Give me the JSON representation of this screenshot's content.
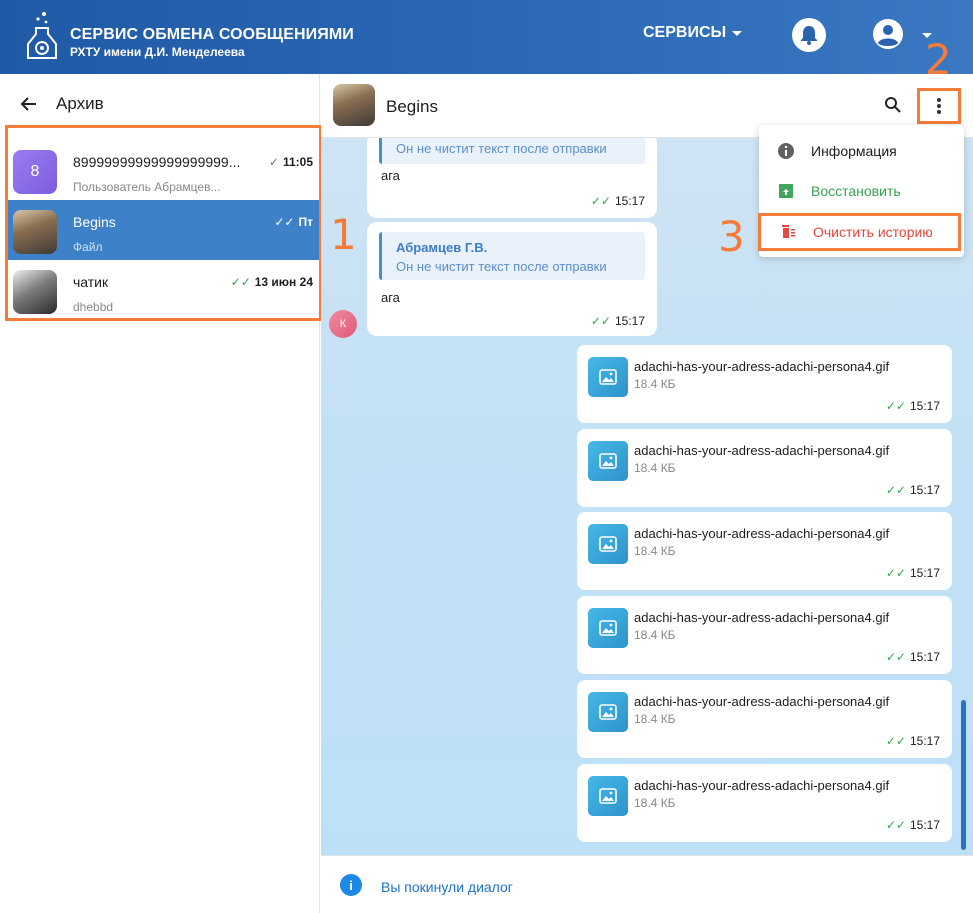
{
  "header": {
    "title": "СЕРВИС ОБМЕНА СООБЩЕНИЯМИ",
    "subtitle": "РХТУ имени Д.И. Менделеева",
    "services_label": "СЕРВИСЫ"
  },
  "archive": {
    "title": "Архив",
    "chats": [
      {
        "avatar_letter": "8",
        "name": "89999999999999999999...",
        "preview": "Пользователь Абрамцев...",
        "time": "11:05"
      },
      {
        "name": "Begins",
        "preview": "Файл",
        "time": "Пт"
      },
      {
        "name": "чатик",
        "preview": "dhebbd",
        "time": "13 июн 24"
      }
    ]
  },
  "chat": {
    "title": "Begins",
    "messages": [
      {
        "quote_text": "Он не чистит текст после отправки",
        "text": "ага",
        "time": "15:17"
      },
      {
        "quote_author": "Абрамцев Г.В.",
        "quote_text": "Он не чистит текст после отправки",
        "text": "ага",
        "time": "15:17",
        "sender_initial": "К"
      }
    ],
    "files": [
      {
        "name": "adachi-has-your-adress-adachi-persona4.gif",
        "size": "18.4 КБ",
        "time": "15:17"
      },
      {
        "name": "adachi-has-your-adress-adachi-persona4.gif",
        "size": "18.4 КБ",
        "time": "15:17"
      },
      {
        "name": "adachi-has-your-adress-adachi-persona4.gif",
        "size": "18.4 КБ",
        "time": "15:17"
      },
      {
        "name": "adachi-has-your-adress-adachi-persona4.gif",
        "size": "18.4 КБ",
        "time": "15:17"
      },
      {
        "name": "adachi-has-your-adress-adachi-persona4.gif",
        "size": "18.4 КБ",
        "time": "15:17"
      },
      {
        "name": "adachi-has-your-adress-adachi-persona4.gif",
        "size": "18.4 КБ",
        "time": "15:17"
      }
    ],
    "footer_text": "Вы покинули диалог"
  },
  "menu": {
    "info": "Информация",
    "restore": "Восстановить",
    "clear": "Очистить историю"
  },
  "annotations": {
    "one": "1",
    "two": "2",
    "three": "3"
  },
  "colors": {
    "accent": "#3d82c8",
    "annotation": "#f47b3a",
    "restore": "#37a352",
    "danger": "#e5483e"
  }
}
